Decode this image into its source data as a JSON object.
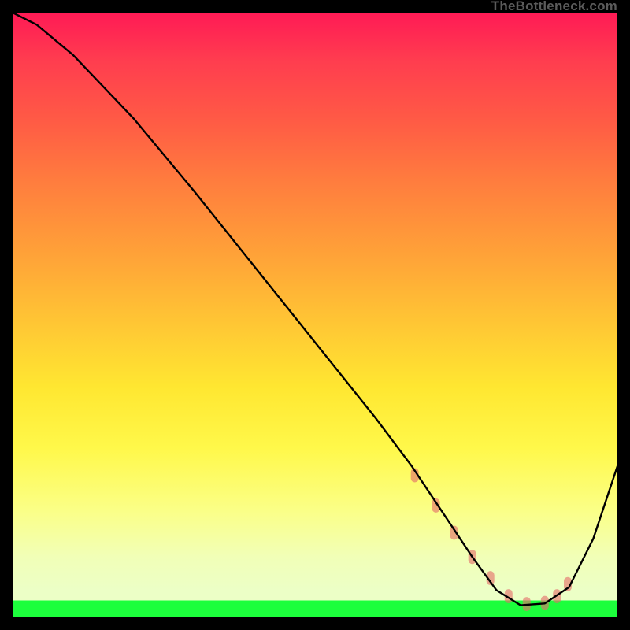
{
  "watermark": "TheBottleneck.com",
  "chart_data": {
    "type": "line",
    "title": "",
    "xlabel": "",
    "ylabel": "",
    "xlim": [
      0,
      100
    ],
    "ylim": [
      0,
      100
    ],
    "grid": false,
    "legend": false,
    "background_gradient": {
      "direction": "vertical",
      "stops": [
        {
          "pos": 0,
          "color": "#ff1a55"
        },
        {
          "pos": 40,
          "color": "#ffa238"
        },
        {
          "pos": 72,
          "color": "#fff84a"
        },
        {
          "pos": 95,
          "color": "#ecffc6"
        },
        {
          "pos": 100,
          "color": "#1cff3c"
        }
      ]
    },
    "series": [
      {
        "name": "bottleneck-curve",
        "x": [
          0,
          4,
          10,
          20,
          30,
          40,
          50,
          60,
          66,
          72,
          76,
          80,
          84,
          88,
          92,
          96,
          100
        ],
        "y": [
          100,
          98,
          93,
          82.5,
          70.5,
          58,
          45.5,
          33,
          25,
          16,
          10,
          4.5,
          2,
          2.3,
          5,
          13,
          25
        ]
      }
    ],
    "markers": {
      "name": "highlight-dots",
      "color": "#e46d6a",
      "x": [
        66.5,
        70,
        73,
        76,
        79,
        82,
        85,
        88,
        90,
        91.8
      ],
      "y": [
        23.5,
        18.5,
        14,
        10,
        6.5,
        3.5,
        2.2,
        2.4,
        3.5,
        5.5
      ]
    }
  }
}
